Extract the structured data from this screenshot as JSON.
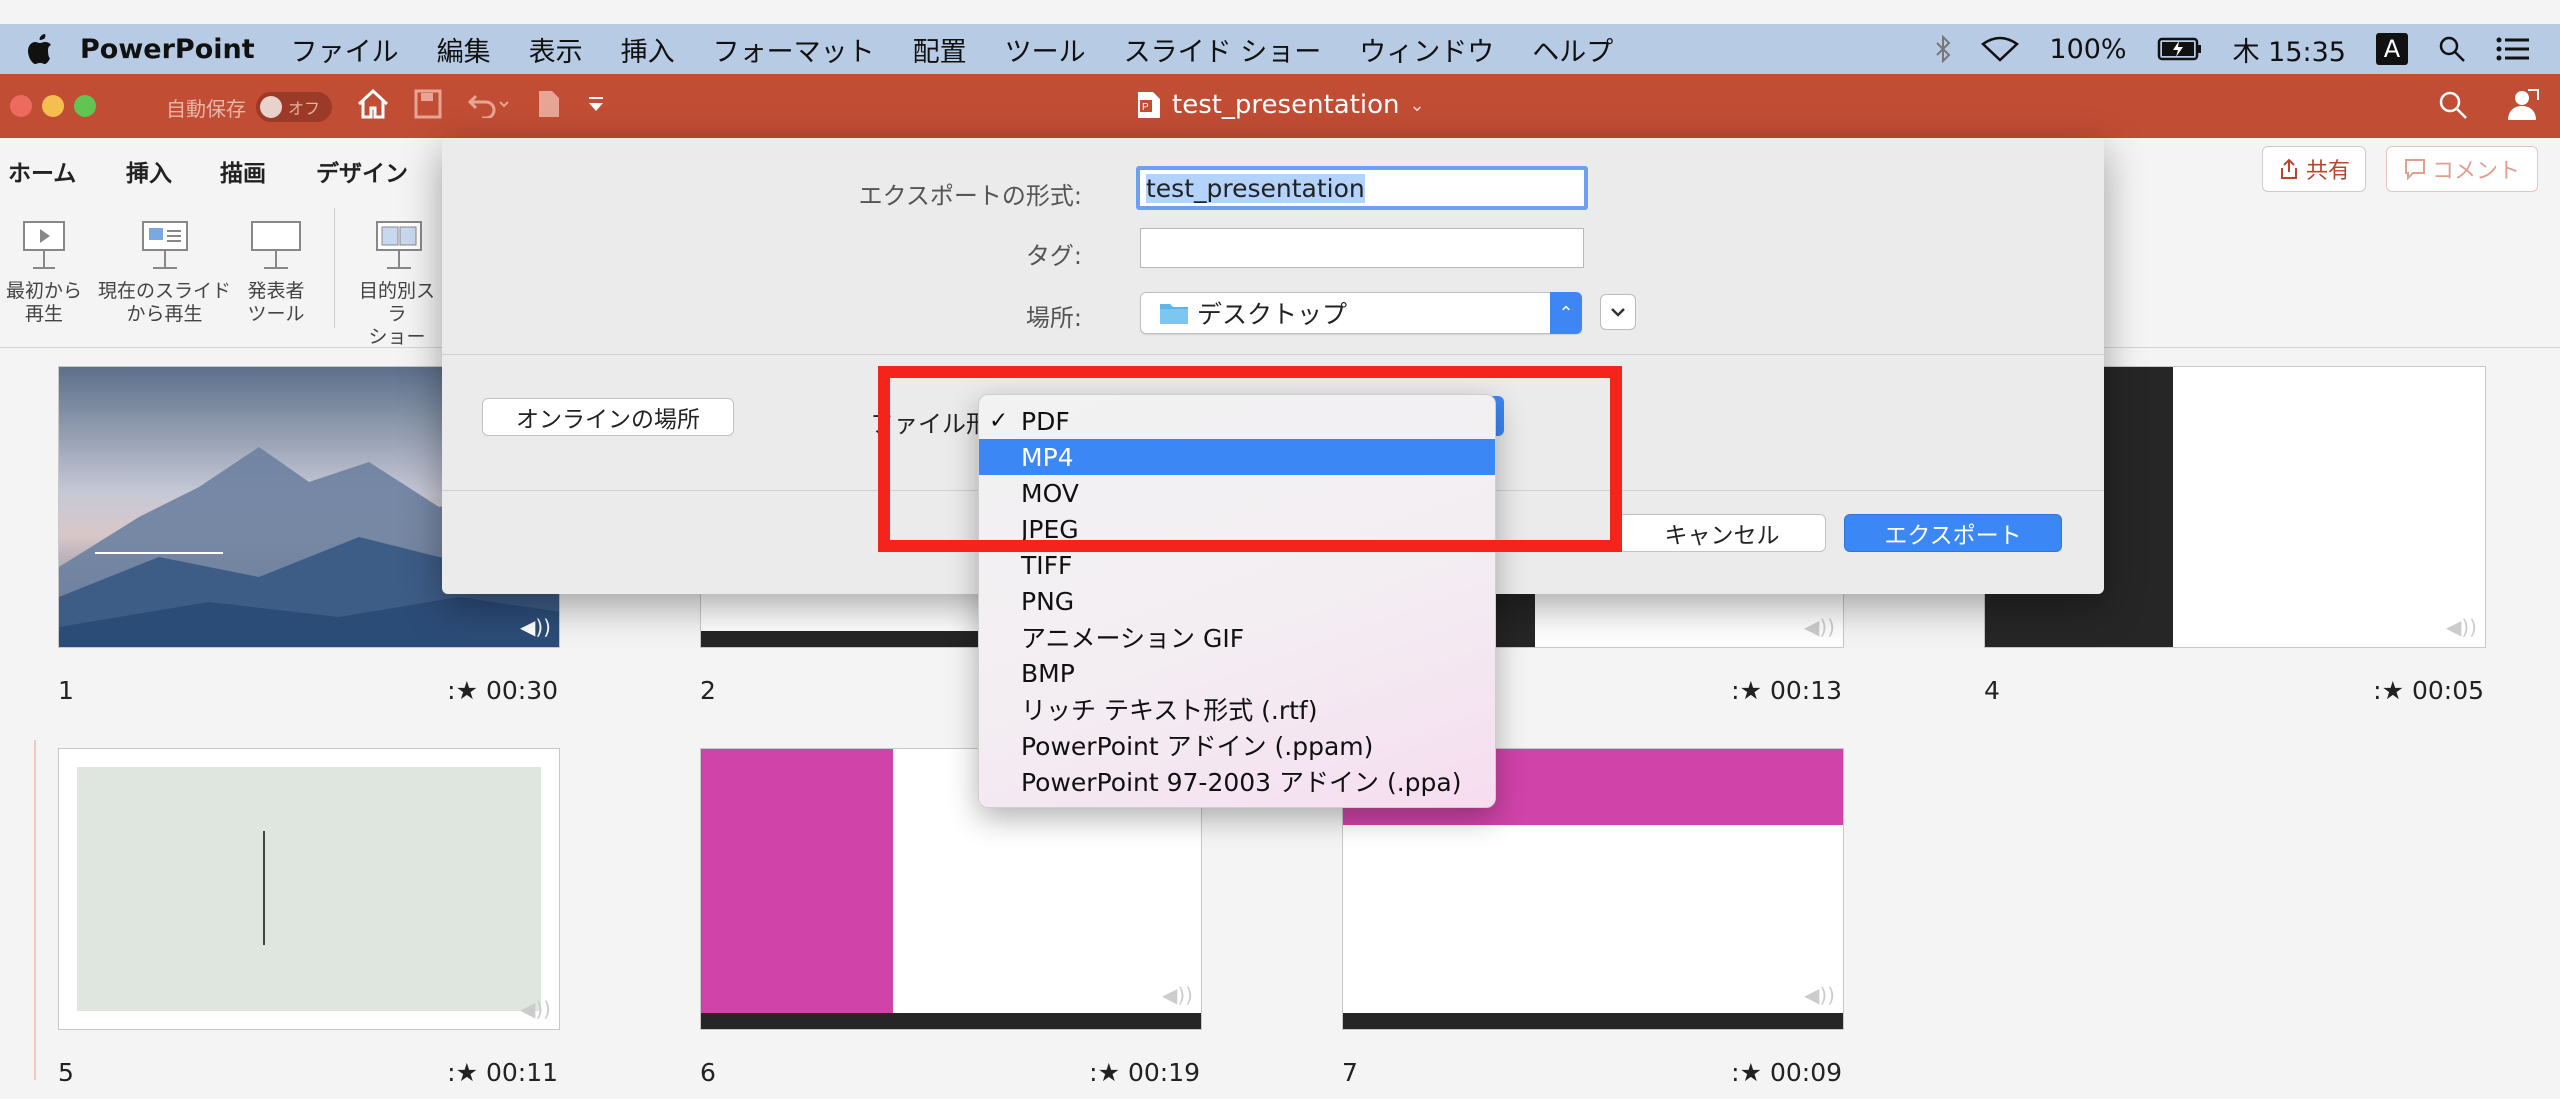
{
  "menubar": {
    "app": "PowerPoint",
    "items": [
      "ファイル",
      "編集",
      "表示",
      "挿入",
      "フォーマット",
      "配置",
      "ツール",
      "スライド ショー",
      "ウィンドウ",
      "ヘルプ"
    ],
    "battery": "100%",
    "clock": "木 15:35",
    "input_source": "A"
  },
  "titlebar": {
    "autosave_label": "自動保存",
    "autosave_state": "オフ",
    "document_title": "test_presentation"
  },
  "ribbon": {
    "tabs": [
      "ホーム",
      "挿入",
      "描画",
      "デザイン"
    ],
    "buttons": [
      {
        "line1": "最初から",
        "line2": "再生"
      },
      {
        "line1": "現在のスライド",
        "line2": "から再生"
      },
      {
        "line1": "発表者",
        "line2": "ツール"
      },
      {
        "line1": "目的別スラ",
        "line2": "ショー"
      }
    ],
    "share": "共有",
    "comment": "コメント"
  },
  "slides": [
    {
      "num": "1",
      "time": "00:30"
    },
    {
      "num": "2",
      "time": ""
    },
    {
      "num": "",
      "time": "00:13"
    },
    {
      "num": "4",
      "time": "00:05"
    },
    {
      "num": "5",
      "time": "00:11"
    },
    {
      "num": "6",
      "time": "00:19"
    },
    {
      "num": "7",
      "time": "00:09"
    }
  ],
  "export_dialog": {
    "export_as_label": "エクスポートの形式:",
    "export_as_value": "test_presentation",
    "tags_label": "タグ:",
    "tags_value": "",
    "where_label": "場所:",
    "where_value": "デスクトップ",
    "online_button": "オンラインの場所",
    "format_label": "ファイル形式",
    "cancel": "キャンセル",
    "export": "エクスポート"
  },
  "format_menu": {
    "checked": "PDF",
    "highlighted": "MP4",
    "options": [
      "PDF",
      "MP4",
      "MOV",
      "JPEG",
      "TIFF",
      "PNG",
      "アニメーション GIF",
      "BMP",
      "リッチ テキスト形式 (.rtf)",
      "PowerPoint アドイン (.ppam)",
      "PowerPoint 97-2003 アドイン (.ppa)"
    ]
  },
  "colors": {
    "menubar": "#b8cbe5",
    "titlebar": "#c14d34",
    "accent_blue": "#3b87f5",
    "annotation_red": "#f4231b",
    "slide_magenta": "#d043a8"
  }
}
